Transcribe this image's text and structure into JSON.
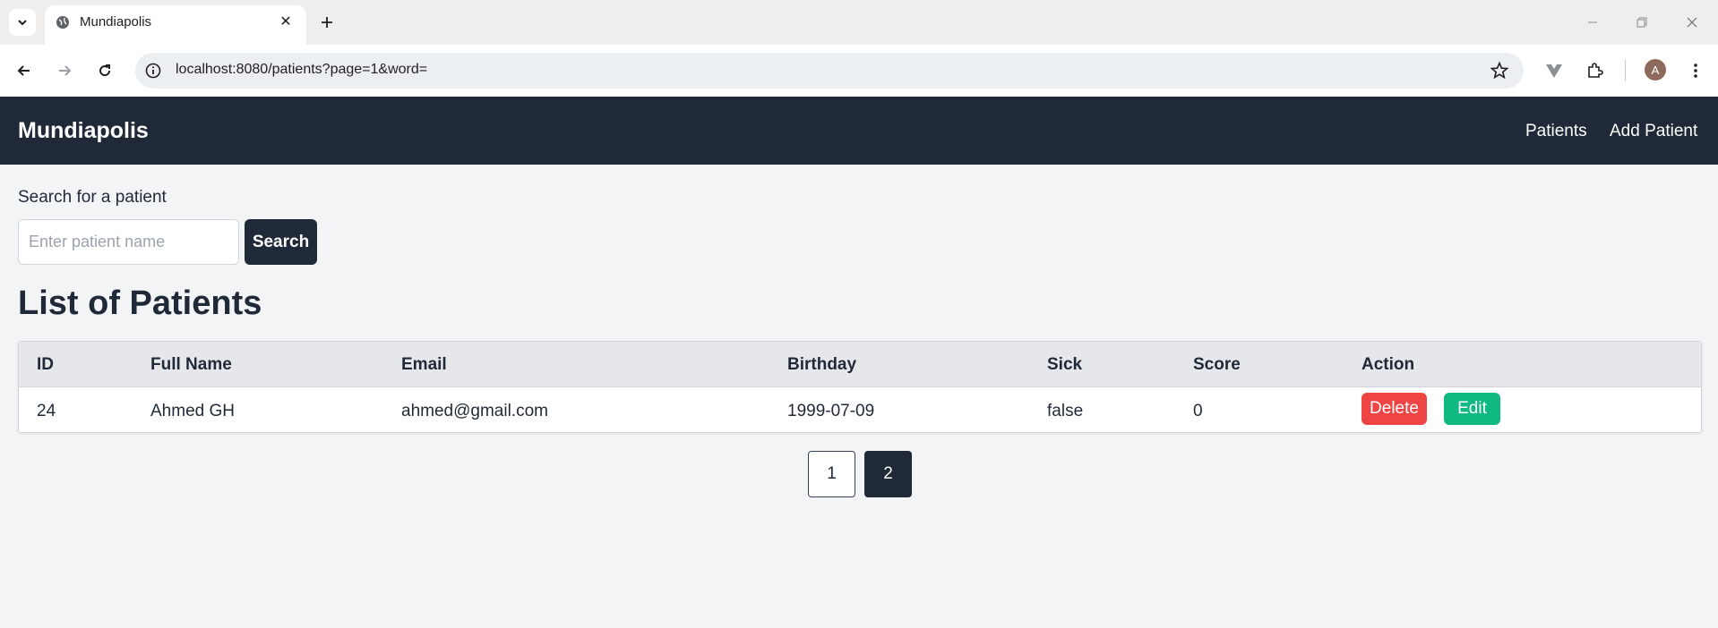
{
  "browser": {
    "tab_title": "Mundiapolis",
    "tab_close": "✕",
    "new_tab": "+",
    "url": "localhost:8080/patients?page=1&word=",
    "profile_initial": "A"
  },
  "navbar": {
    "brand": "Mundiapolis",
    "links": [
      "Patients",
      "Add Patient"
    ]
  },
  "search": {
    "label": "Search for a patient",
    "placeholder": "Enter patient name",
    "value": "",
    "button": "Search"
  },
  "list": {
    "title": "List of Patients",
    "headers": [
      "ID",
      "Full Name",
      "Email",
      "Birthday",
      "Sick",
      "Score",
      "Action"
    ],
    "rows": [
      {
        "id": "24",
        "full_name": "Ahmed GH",
        "email": "ahmed@gmail.com",
        "birthday": "1999-07-09",
        "sick": "false",
        "score": "0",
        "delete_label": "Delete",
        "edit_label": "Edit"
      }
    ]
  },
  "pagination": {
    "pages": [
      "1",
      "2"
    ],
    "active": "2"
  },
  "colors": {
    "navbar": "#1f2937",
    "delete": "#ef4444",
    "edit": "#10b981",
    "background": "#f3f4f6"
  }
}
